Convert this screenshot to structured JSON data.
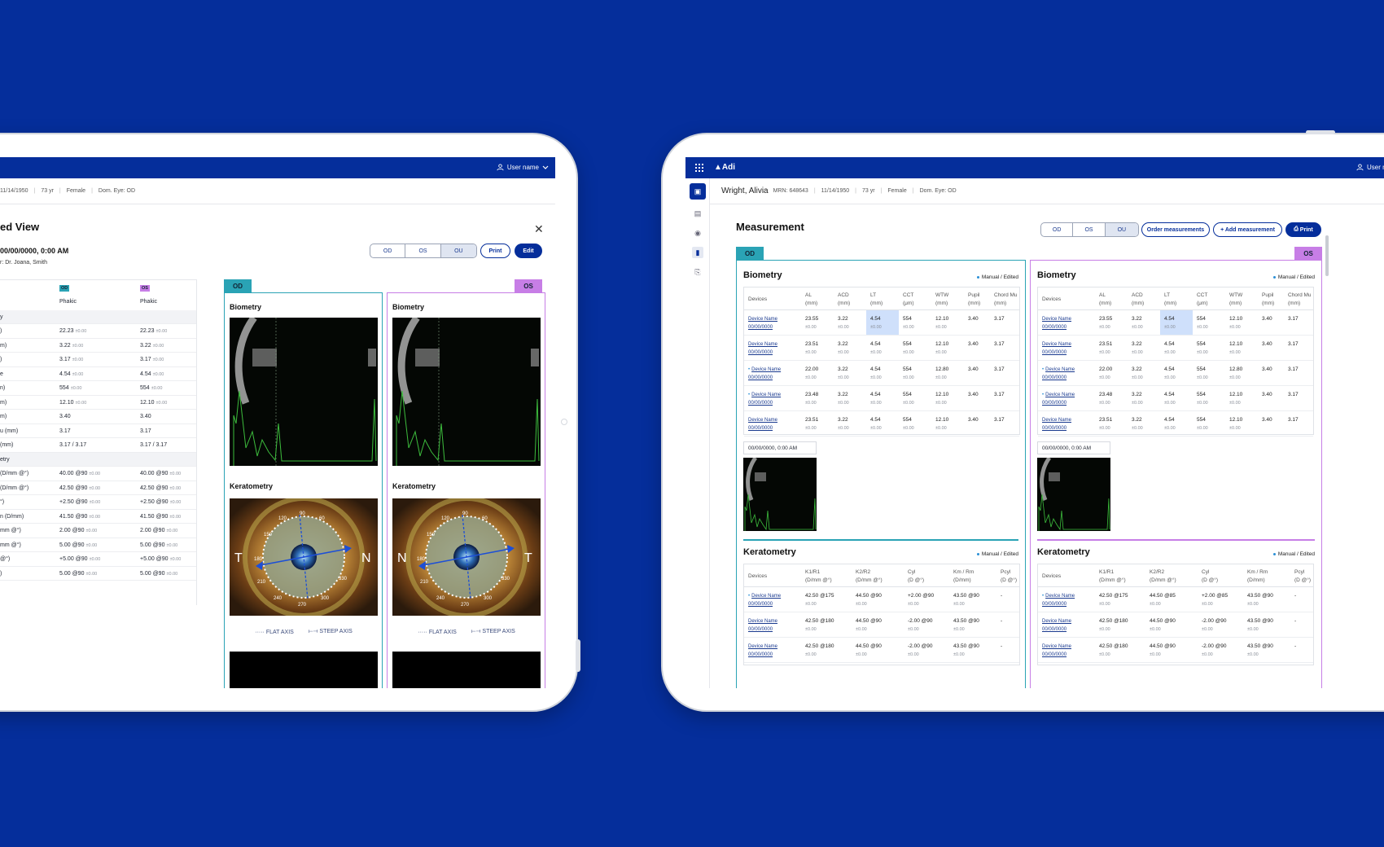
{
  "colors": {
    "brand": "#052e9b",
    "od": "#2aa3b5",
    "os": "#c77ee6",
    "highlight": "#cfe0fb"
  },
  "left": {
    "user": "User name",
    "patient_line": [
      "11/14/1950",
      "73 yr",
      "Female",
      "Dom. Eye: OD"
    ],
    "title": "ed View",
    "date": "00/00/0000, 0:00 AM",
    "doctor": "r: Dr. Joana, Smith",
    "eye_toggle": [
      "OD",
      "OS",
      "OU"
    ],
    "print": "Print",
    "edit": "Edit",
    "od_tag": "OD",
    "os_tag": "OS",
    "od_badge": "OD",
    "os_badge": "OS",
    "lens_od": "Phakic",
    "lens_os": "Phakic",
    "rows": [
      {
        "label": "y",
        "od": "",
        "odsub": "",
        "os": "",
        "ossub": "",
        "grp": true
      },
      {
        "label": ")",
        "od": "22.23",
        "odsub": "±0.00",
        "os": "22.23",
        "ossub": "±0.00"
      },
      {
        "label": "m)",
        "od": "3.22",
        "odsub": "±0.00",
        "os": "3.22",
        "ossub": "±0.00"
      },
      {
        "label": ")",
        "od": "3.17",
        "odsub": "±0.00",
        "os": "3.17",
        "ossub": "±0.00"
      },
      {
        "label": "e",
        "od": "4.54",
        "odsub": "±0.00",
        "os": "4.54",
        "ossub": "±0.00"
      },
      {
        "label": "n)",
        "od": "554",
        "odsub": "±0.00",
        "os": "554",
        "ossub": "±0.00"
      },
      {
        "label": "m)",
        "od": "12.10",
        "odsub": "±0.00",
        "os": "12.10",
        "ossub": "±0.00"
      },
      {
        "label": "m)",
        "od": "3.40",
        "odsub": "",
        "os": "3.40",
        "ossub": ""
      },
      {
        "label": "u (mm)",
        "od": "3.17",
        "odsub": "",
        "os": "3.17",
        "ossub": ""
      },
      {
        "label": "(mm)",
        "od": "3.17 / 3.17",
        "odsub": "",
        "os": "3.17 / 3.17",
        "ossub": ""
      },
      {
        "label": "etry",
        "od": "",
        "odsub": "",
        "os": "",
        "ossub": "",
        "grp": true
      },
      {
        "label": "(D/mm @°)",
        "od": "40.00 @90",
        "odsub": "±0.00",
        "os": "40.00 @90",
        "ossub": "±0.00"
      },
      {
        "label": "(D/mm @°)",
        "od": "42.50 @90",
        "odsub": "±0.00",
        "os": "42.50 @90",
        "ossub": "±0.00"
      },
      {
        "label": "°)",
        "od": "+2.50 @90",
        "odsub": "±0.00",
        "os": "+2.50 @90",
        "ossub": "±0.00"
      },
      {
        "label": "n (D/mm)",
        "od": "41.50 @90",
        "odsub": "±0.00",
        "os": "41.50 @90",
        "ossub": "±0.00"
      },
      {
        "label": "mm @°)",
        "od": "2.00 @90",
        "odsub": "±0.00",
        "os": "2.00 @90",
        "ossub": "±0.00"
      },
      {
        "label": "mm @°)",
        "od": "5.00 @90",
        "odsub": "±0.00",
        "os": "5.00 @90",
        "ossub": "±0.00"
      },
      {
        "label": "@°)",
        "od": "+5.00 @90",
        "odsub": "±0.00",
        "os": "+5.00 @90",
        "ossub": "±0.00"
      },
      {
        "label": ")",
        "od": "5.00 @90",
        "odsub": "±0.00",
        "os": "5.00 @90",
        "ossub": "±0.00"
      }
    ],
    "biometry": "Biometry",
    "keratometry": "Keratometry",
    "flat_axis": "FLAT AXIS",
    "steep_axis": "STEEP AXIS",
    "od_letters": [
      "T",
      "N"
    ],
    "os_letters": [
      "N",
      "T"
    ],
    "dial": [
      "90",
      "60",
      "30",
      "120",
      "150",
      "180",
      "210",
      "240",
      "270",
      "300",
      "330"
    ]
  },
  "right": {
    "logo": "Adi",
    "user": "User name",
    "patient_name": "Wright, Alivia",
    "patient_line": [
      "MRN: 648643",
      "11/14/1950",
      "73 yr",
      "Female",
      "Dom. Eye: OD"
    ],
    "title": "Measurement",
    "eye_toggle": [
      "OD",
      "OS",
      "OU"
    ],
    "order": "Order measurements",
    "add": "+ Add measurement",
    "print": "Print",
    "od_tag": "OD",
    "os_tag": "OS",
    "biometry": "Biometry",
    "keratometry": "Keratometry",
    "manual": "Manual / Edited",
    "timestamp": "00/00/0000, 0:00 AM",
    "bio_headers": [
      "Devices",
      "AL\n(mm)",
      "ACD\n(mm)",
      "LT\n(mm)",
      "CCT\n(μm)",
      "WTW\n(mm)",
      "Pupil\n(mm)",
      "Chord Mu\n(mm)"
    ],
    "bio_rows": [
      {
        "device": "Device Name",
        "date": "00/00/0000",
        "dot": false,
        "vals": [
          "23.55",
          "3.22",
          "4.54",
          "554",
          "12.10",
          "3.40",
          "3.17"
        ]
      },
      {
        "device": "Device Name",
        "date": "00/00/0000",
        "dot": false,
        "vals": [
          "23.51",
          "3.22",
          "4.54",
          "554",
          "12.10",
          "3.40",
          "3.17"
        ]
      },
      {
        "device": "Device Name",
        "date": "00/00/0000",
        "dot": true,
        "vals": [
          "22.00",
          "3.22",
          "4.54",
          "554",
          "12.80",
          "3.40",
          "3.17"
        ]
      },
      {
        "device": "Device Name",
        "date": "00/00/0000",
        "dot": true,
        "vals": [
          "23.48",
          "3.22",
          "4.54",
          "554",
          "12.10",
          "3.40",
          "3.17"
        ]
      },
      {
        "device": "Device Name",
        "date": "00/00/0000",
        "dot": false,
        "vals": [
          "23.51",
          "3.22",
          "4.54",
          "554",
          "12.10",
          "3.40",
          "3.17"
        ]
      }
    ],
    "sub": "±0.00",
    "ker_headers": [
      "Devices",
      "K1/R1\n(D/mm @°)",
      "K2/R2\n(D/mm @°)",
      "Cyl\n(D @°)",
      "Km / Rm\n(D/mm)",
      "Pcyl\n(D @°)"
    ],
    "ker_rows_od": [
      {
        "device": "Device Name",
        "date": "00/00/0000",
        "dot": true,
        "vals": [
          "42.50 @175",
          "44.50 @90",
          "+2.00 @90",
          "43.50 @90",
          "-"
        ]
      },
      {
        "device": "Device Name",
        "date": "00/00/0000",
        "dot": false,
        "vals": [
          "42.50 @180",
          "44.50 @90",
          "-2.00 @90",
          "43.50 @90",
          "-"
        ]
      },
      {
        "device": "Device Name",
        "date": "00/00/0000",
        "dot": false,
        "vals": [
          "42.50 @180",
          "44.50 @90",
          "-2.00 @90",
          "43.50 @90",
          "-"
        ]
      }
    ],
    "ker_rows_os": [
      {
        "device": "Device Name",
        "date": "00/00/0000",
        "dot": true,
        "vals": [
          "42.50 @175",
          "44.50 @85",
          "+2.00 @85",
          "43.50 @90",
          "-"
        ]
      },
      {
        "device": "Device Name",
        "date": "00/00/0000",
        "dot": false,
        "vals": [
          "42.50 @180",
          "44.50 @90",
          "-2.00 @90",
          "43.50 @90",
          "-"
        ]
      },
      {
        "device": "Device Name",
        "date": "00/00/0000",
        "dot": false,
        "vals": [
          "42.50 @180",
          "44.50 @90",
          "-2.00 @90",
          "43.50 @90",
          "-"
        ]
      }
    ]
  }
}
